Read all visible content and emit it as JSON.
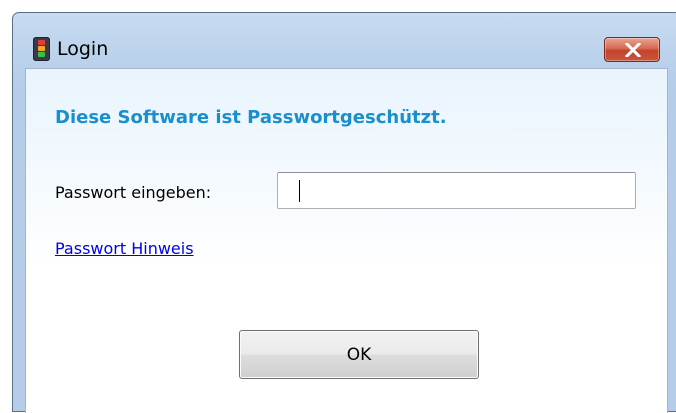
{
  "window": {
    "title": "Login",
    "icon": "app-traffic-light-icon",
    "close_icon": "close-x-icon"
  },
  "dialog": {
    "heading": "Diese Software ist Passwortgeschützt.",
    "password_label": "Passwort eingeben:",
    "password_value": "",
    "hint_link": "Passwort Hinweis",
    "ok_label": "OK"
  },
  "colors": {
    "heading": "#1a8fcd",
    "link": "#0000ee",
    "close_button": "#c9553c"
  }
}
